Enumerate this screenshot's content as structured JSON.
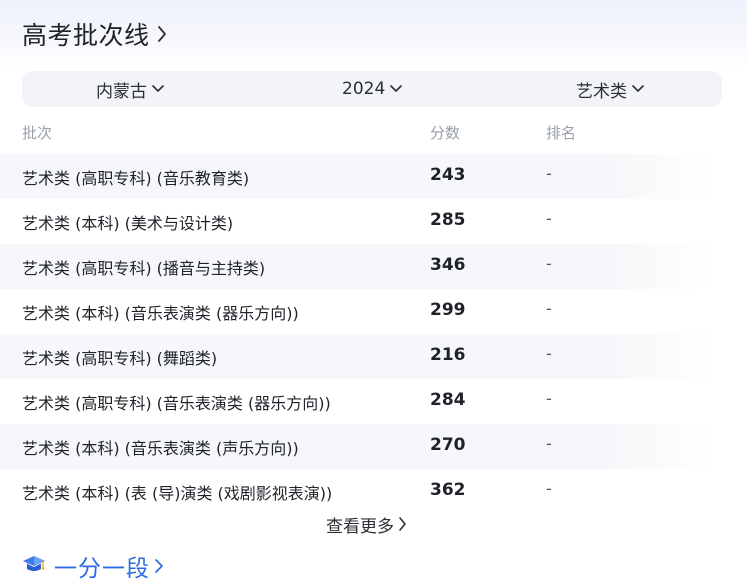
{
  "header": {
    "title": "高考批次线"
  },
  "filters": {
    "province": "内蒙古",
    "year": "2024",
    "category": "艺术类"
  },
  "table": {
    "columns": {
      "batch": "批次",
      "score": "分数",
      "rank": "排名"
    },
    "rows": [
      {
        "name": "艺术类 (高职专科) (音乐教育类)",
        "score": "243",
        "rank": "-"
      },
      {
        "name": "艺术类 (本科) (美术与设计类)",
        "score": "285",
        "rank": "-"
      },
      {
        "name": "艺术类 (高职专科) (播音与主持类)",
        "score": "346",
        "rank": "-"
      },
      {
        "name": "艺术类 (本科) (音乐表演类 (器乐方向))",
        "score": "299",
        "rank": "-"
      },
      {
        "name": "艺术类 (高职专科) (舞蹈类)",
        "score": "216",
        "rank": "-"
      },
      {
        "name": "艺术类 (高职专科) (音乐表演类 (器乐方向))",
        "score": "284",
        "rank": "-"
      },
      {
        "name": "艺术类 (本科) (音乐表演类 (声乐方向))",
        "score": "270",
        "rank": "-"
      },
      {
        "name": "艺术类 (本科) (表 (导)演类 (戏剧影视表演))",
        "score": "362",
        "rank": "-"
      }
    ]
  },
  "more": {
    "label": "查看更多"
  },
  "section2": {
    "label": "一分一段",
    "icon": "graduation-cap-icon"
  },
  "colors": {
    "accent": "#2f6be6",
    "row_shade": "#f6f7fa",
    "filter_bg": "#f2f4f9"
  }
}
